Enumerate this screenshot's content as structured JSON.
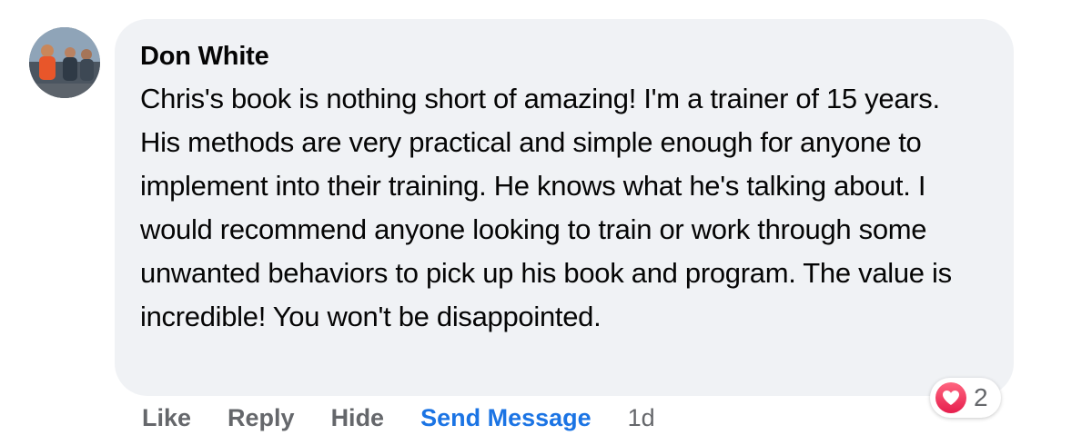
{
  "comment": {
    "author": "Don White",
    "text": "Chris's book is nothing short of amazing! I'm a trainer of 15 years. His methods are very practical and simple enough for anyone to implement into their training. He knows what he's talking about. I would recommend anyone looking to train or work through some unwanted behaviors to pick up his book and program. The value is incredible! You won't be disappointed.",
    "reaction_icon": "love-heart-icon",
    "reaction_count": "2"
  },
  "actions": {
    "like": "Like",
    "reply": "Reply",
    "hide": "Hide",
    "send_message": "Send Message",
    "timestamp": "1d"
  },
  "colors": {
    "bubble": "#f0f2f5",
    "link": "#1b74e4",
    "muted": "#65676b",
    "love": "#f33e58"
  }
}
